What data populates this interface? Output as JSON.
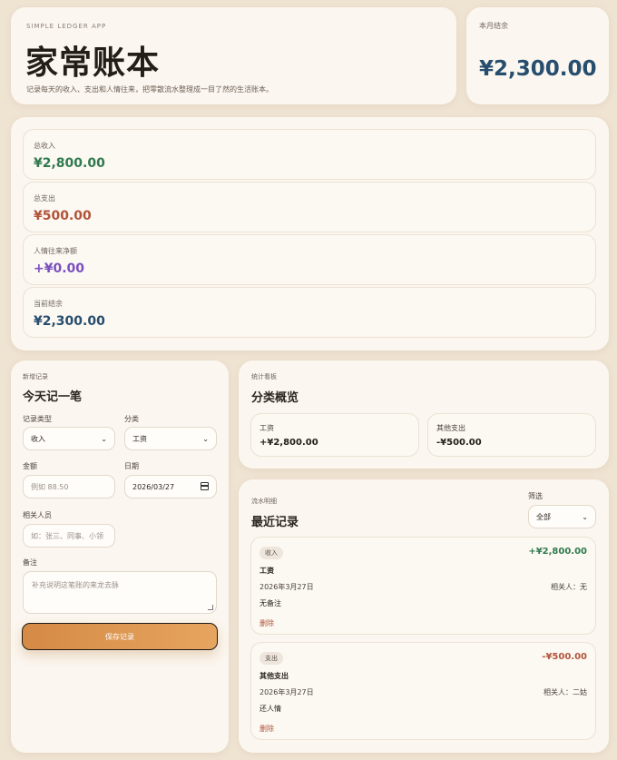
{
  "header": {
    "eyebrow": "SIMPLE LEDGER APP",
    "title": "家常账本",
    "description": "记录每天的收入、支出和人情往来，把零散流水整理成一目了然的生活账本。"
  },
  "balance_card": {
    "label": "本月结余",
    "amount": "¥2,300.00"
  },
  "stats": [
    {
      "label": "总收入",
      "value": "¥2,800.00",
      "color": "#2f7a4f"
    },
    {
      "label": "总支出",
      "value": "¥500.00",
      "color": "#b2543a"
    },
    {
      "label": "人情往来净额",
      "value": "+¥0.00",
      "color": "#7b4fc0"
    },
    {
      "label": "当前结余",
      "value": "¥2,300.00",
      "color": "#274e6e"
    }
  ],
  "form": {
    "eyebrow": "新增记录",
    "title": "今天记一笔",
    "type_label": "记录类型",
    "type_value": "收入",
    "category_label": "分类",
    "category_value": "工资",
    "amount_label": "金额",
    "amount_placeholder": "例如 88.50",
    "date_label": "日期",
    "date_value": "2026/03/27",
    "person_label": "相关人员",
    "person_placeholder": "如：张三、同事、小领",
    "note_label": "备注",
    "note_placeholder": "补充说明这笔账的来龙去脉",
    "save_label": "保存记录"
  },
  "overview": {
    "eyebrow": "统计看板",
    "title": "分类概览",
    "items": [
      {
        "label": "工资",
        "value": "+¥2,800.00"
      },
      {
        "label": "其他支出",
        "value": "-¥500.00"
      }
    ]
  },
  "records": {
    "eyebrow": "流水明细",
    "title": "最近记录",
    "filter_label": "筛选",
    "filter_value": "全部",
    "items": [
      {
        "badge": "收入",
        "amount": "+¥2,800.00",
        "amount_color": "#2f7a4f",
        "category": "工资",
        "date": "2026年3月27日",
        "person": "相关人：无",
        "note": "无备注",
        "delete_label": "删除"
      },
      {
        "badge": "支出",
        "amount": "-¥500.00",
        "amount_color": "#b2543a",
        "category": "其他支出",
        "date": "2026年3月27日",
        "person": "相关人：二姑",
        "note": "还人情",
        "delete_label": "删除"
      }
    ]
  }
}
